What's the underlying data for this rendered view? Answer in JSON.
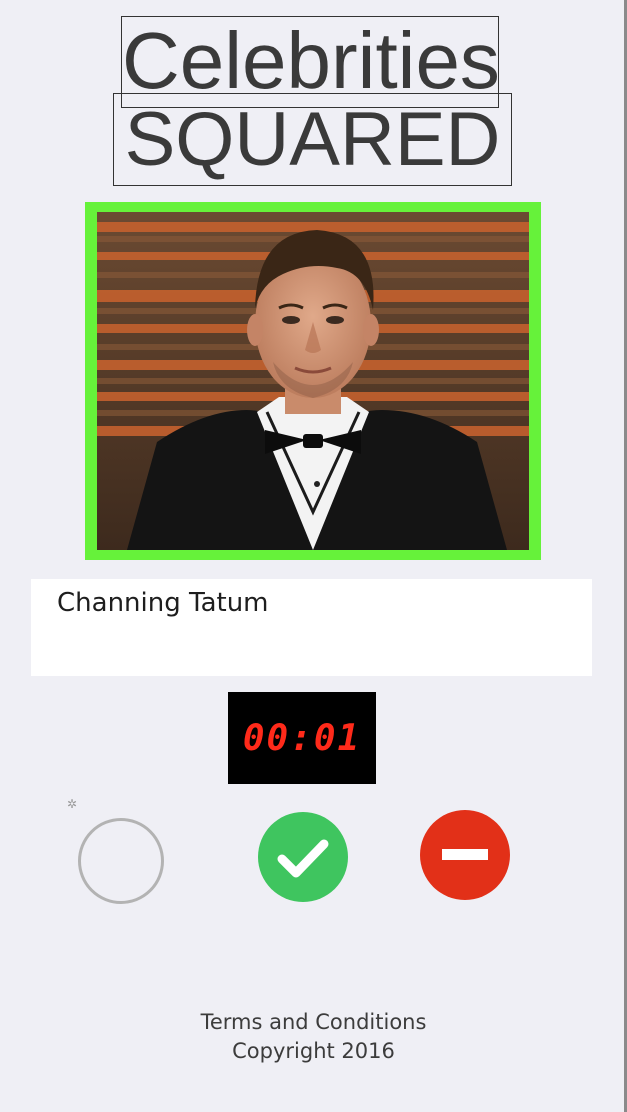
{
  "title": {
    "line1": "Celebrities",
    "line2": "SQUARED"
  },
  "celebrity": {
    "name": "Channing Tatum",
    "photo_frame_color": "#66f23a"
  },
  "timer": {
    "display": "00:01",
    "color": "#ff2a1a"
  },
  "loading_indicator": {
    "icon": "spinner-icon"
  },
  "actions": {
    "neutral_icon": "empty-circle-icon",
    "accept_icon": "checkmark-icon",
    "accept_color": "#3fc55f",
    "reject_icon": "minus-icon",
    "reject_color": "#e23018"
  },
  "footer": {
    "terms": "Terms and Conditions",
    "copyright": "Copyright 2016"
  }
}
